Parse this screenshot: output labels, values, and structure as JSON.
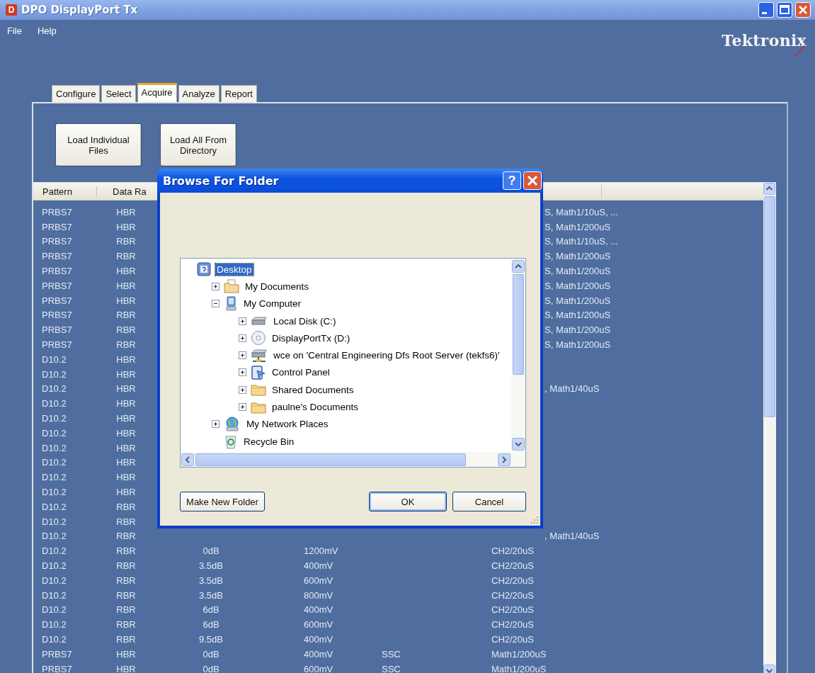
{
  "window": {
    "title": "DPO DisplayPort Tx",
    "app_icon": "D"
  },
  "menu": [
    "File",
    "Help"
  ],
  "logo": "Tektronix",
  "tabs": [
    {
      "label": "Configure",
      "selected": false
    },
    {
      "label": "Select",
      "selected": false
    },
    {
      "label": "Acquire",
      "selected": true
    },
    {
      "label": "Analyze",
      "selected": false
    },
    {
      "label": "Report",
      "selected": false
    }
  ],
  "buttons": [
    "Load Individual Files",
    "Load All From Directory"
  ],
  "table": {
    "columns": [
      "Pattern",
      "Data Ra"
    ],
    "rows": [
      {
        "pattern": "PRBS7",
        "data_rate": "HBR",
        "column_6_tail": "S, Math1/10uS, ..."
      },
      {
        "pattern": "PRBS7",
        "data_rate": "HBR",
        "column_6_tail": "S, Math1/200uS"
      },
      {
        "pattern": "PRBS7",
        "data_rate": "RBR",
        "column_6_tail": "S, Math1/10uS, ..."
      },
      {
        "pattern": "PRBS7",
        "data_rate": "RBR",
        "column_6_tail": "S, Math1/200uS"
      },
      {
        "pattern": "PRBS7",
        "data_rate": "HBR",
        "column_6_tail": "S, Math1/200uS"
      },
      {
        "pattern": "PRBS7",
        "data_rate": "HBR",
        "column_6_tail": "S, Math1/200uS"
      },
      {
        "pattern": "PRBS7",
        "data_rate": "HBR",
        "column_6_tail": "S, Math1/200uS"
      },
      {
        "pattern": "PRBS7",
        "data_rate": "RBR",
        "column_6_tail": "S, Math1/200uS"
      },
      {
        "pattern": "PRBS7",
        "data_rate": "RBR",
        "column_6_tail": "S, Math1/200uS"
      },
      {
        "pattern": "PRBS7",
        "data_rate": "RBR",
        "column_6_tail": "S, Math1/200uS"
      },
      {
        "pattern": "D10.2",
        "data_rate": "HBR"
      },
      {
        "pattern": "D10.2",
        "data_rate": "HBR"
      },
      {
        "pattern": "D10.2",
        "data_rate": "HBR",
        "column_6_tail": ", Math1/40uS"
      },
      {
        "pattern": "D10.2",
        "data_rate": "HBR"
      },
      {
        "pattern": "D10.2",
        "data_rate": "HBR"
      },
      {
        "pattern": "D10.2",
        "data_rate": "HBR"
      },
      {
        "pattern": "D10.2",
        "data_rate": "HBR"
      },
      {
        "pattern": "D10.2",
        "data_rate": "HBR"
      },
      {
        "pattern": "D10.2",
        "data_rate": "HBR"
      },
      {
        "pattern": "D10.2",
        "data_rate": "HBR"
      },
      {
        "pattern": "D10.2",
        "data_rate": "RBR"
      },
      {
        "pattern": "D10.2",
        "data_rate": "RBR"
      },
      {
        "pattern": "D10.2",
        "data_rate": "RBR",
        "column_6_tail": ", Math1/40uS"
      },
      {
        "pattern": "D10.2",
        "data_rate": "RBR",
        "column_3": "0dB",
        "column_4": "1200mV",
        "column_6": "CH2/20uS"
      },
      {
        "pattern": "D10.2",
        "data_rate": "RBR",
        "column_3": "3.5dB",
        "column_4": "400mV",
        "column_6": "CH2/20uS"
      },
      {
        "pattern": "D10.2",
        "data_rate": "RBR",
        "column_3": "3.5dB",
        "column_4": "600mV",
        "column_6": "CH2/20uS"
      },
      {
        "pattern": "D10.2",
        "data_rate": "RBR",
        "column_3": "3.5dB",
        "column_4": "800mV",
        "column_6": "CH2/20uS"
      },
      {
        "pattern": "D10.2",
        "data_rate": "RBR",
        "column_3": "6dB",
        "column_4": "400mV",
        "column_6": "CH2/20uS"
      },
      {
        "pattern": "D10.2",
        "data_rate": "RBR",
        "column_3": "6dB",
        "column_4": "600mV",
        "column_6": "CH2/20uS"
      },
      {
        "pattern": "D10.2",
        "data_rate": "RBR",
        "column_3": "9.5dB",
        "column_4": "400mV",
        "column_6": "CH2/20uS"
      },
      {
        "pattern": "PRBS7",
        "data_rate": "HBR",
        "column_3": "0dB",
        "column_4": "400mV",
        "column_5": "SSC",
        "column_6": "Math1/200uS"
      },
      {
        "pattern": "PRBS7",
        "data_rate": "HBR",
        "column_3": "0dB",
        "column_4": "600mV",
        "column_5": "SSC",
        "column_6": "Math1/200uS"
      }
    ]
  },
  "dialog": {
    "title": "Browse For Folder",
    "help": "?",
    "tree": [
      {
        "label": "Desktop",
        "kind": "desktop",
        "expander": false,
        "selected": true,
        "children": [
          {
            "label": "My Documents",
            "kind": "documents",
            "expander": true,
            "expanded": false,
            "selected": false
          },
          {
            "label": "My Computer",
            "kind": "computer",
            "expander": true,
            "expanded": true,
            "selected": false,
            "children": [
              {
                "label": "Local Disk (C:)",
                "kind": "drive",
                "expander": true,
                "expanded": false,
                "selected": false
              },
              {
                "label": "DisplayPortTx (D:)",
                "kind": "disc",
                "expander": true,
                "expanded": false,
                "selected": false
              },
              {
                "label": "wce on 'Central Engineering Dfs Root Server (tekfs6)'",
                "kind": "network-drive",
                "expander": true,
                "expanded": false,
                "selected": false
              },
              {
                "label": "Control Panel",
                "kind": "control-panel",
                "expander": true,
                "expanded": false,
                "selected": false
              },
              {
                "label": "Shared Documents",
                "kind": "folder",
                "expander": true,
                "expanded": false,
                "selected": false
              },
              {
                "label": "paulne's Documents",
                "kind": "folder",
                "expander": true,
                "expanded": false,
                "selected": false
              }
            ]
          },
          {
            "label": "My Network Places",
            "kind": "network",
            "expander": true,
            "expanded": false,
            "selected": false
          },
          {
            "label": "Recycle Bin",
            "kind": "recycle-bin",
            "expander": false,
            "selected": false
          }
        ]
      }
    ],
    "buttons": [
      {
        "label": "Make New Folder",
        "default": false
      },
      {
        "label": "OK",
        "default": true
      },
      {
        "label": "Cancel",
        "default": false
      }
    ]
  }
}
